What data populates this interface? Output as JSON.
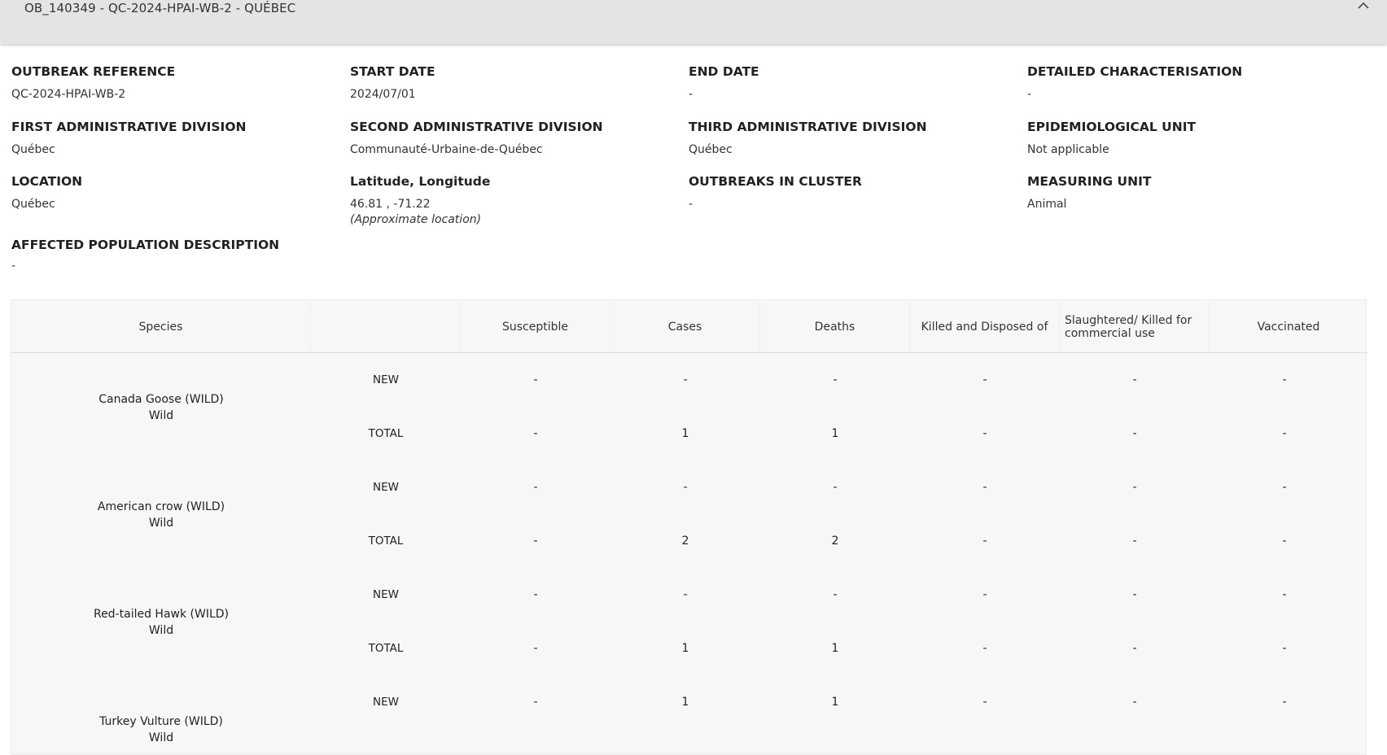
{
  "header": {
    "title": "OB_140349 - QC-2024-HPAI-WB-2 - QUÉBEC",
    "collapse_icon": "chevron-up-icon"
  },
  "details": {
    "outbreak_reference": {
      "label": "OUTBREAK REFERENCE",
      "value": "QC-2024-HPAI-WB-2"
    },
    "start_date": {
      "label": "START DATE",
      "value": "2024/07/01"
    },
    "end_date": {
      "label": "END DATE",
      "value": "-"
    },
    "detailed_characterisation": {
      "label": "DETAILED CHARACTERISATION",
      "value": "-"
    },
    "first_admin_division": {
      "label": "FIRST ADMINISTRATIVE DIVISION",
      "value": "Québec"
    },
    "second_admin_division": {
      "label": "SECOND ADMINISTRATIVE DIVISION",
      "value": "Communauté-Urbaine-de-Québec"
    },
    "third_admin_division": {
      "label": "THIRD ADMINISTRATIVE DIVISION",
      "value": "Québec"
    },
    "epidemiological_unit": {
      "label": "EPIDEMIOLOGICAL UNIT",
      "value": "Not applicable"
    },
    "location": {
      "label": "LOCATION",
      "value": "Québec"
    },
    "lat_long": {
      "label": "Latitude, Longitude",
      "value": "46.81 , -71.22",
      "note": "(Approximate location)"
    },
    "outbreaks_in_cluster": {
      "label": "OUTBREAKS IN CLUSTER",
      "value": "-"
    },
    "measuring_unit": {
      "label": "MEASURING UNIT",
      "value": "Animal"
    },
    "affected_population": {
      "label": "AFFECTED POPULATION DESCRIPTION",
      "value": "-"
    }
  },
  "table": {
    "columns": {
      "species": "Species",
      "type": "",
      "susceptible": "Susceptible",
      "cases": "Cases",
      "deaths": "Deaths",
      "killed": "Killed and Disposed of",
      "slaughtered": "Slaughtered/ Killed for commercial use",
      "vaccinated": "Vaccinated"
    },
    "rows": [
      {
        "species": "Canada Goose (WILD)",
        "category": "Wild",
        "new": {
          "label": "NEW",
          "susceptible": "-",
          "cases": "-",
          "deaths": "-",
          "killed": "-",
          "slaughtered": "-",
          "vaccinated": "-"
        },
        "total": {
          "label": "TOTAL",
          "susceptible": "-",
          "cases": "1",
          "deaths": "1",
          "killed": "-",
          "slaughtered": "-",
          "vaccinated": "-"
        }
      },
      {
        "species": "American crow (WILD)",
        "category": "Wild",
        "new": {
          "label": "NEW",
          "susceptible": "-",
          "cases": "-",
          "deaths": "-",
          "killed": "-",
          "slaughtered": "-",
          "vaccinated": "-"
        },
        "total": {
          "label": "TOTAL",
          "susceptible": "-",
          "cases": "2",
          "deaths": "2",
          "killed": "-",
          "slaughtered": "-",
          "vaccinated": "-"
        }
      },
      {
        "species": "Red-tailed Hawk (WILD)",
        "category": "Wild",
        "new": {
          "label": "NEW",
          "susceptible": "-",
          "cases": "-",
          "deaths": "-",
          "killed": "-",
          "slaughtered": "-",
          "vaccinated": "-"
        },
        "total": {
          "label": "TOTAL",
          "susceptible": "-",
          "cases": "1",
          "deaths": "1",
          "killed": "-",
          "slaughtered": "-",
          "vaccinated": "-"
        }
      },
      {
        "species": "Turkey Vulture (WILD)",
        "category": "Wild",
        "new": {
          "label": "NEW",
          "susceptible": "-",
          "cases": "1",
          "deaths": "1",
          "killed": "-",
          "slaughtered": "-",
          "vaccinated": "-"
        }
      }
    ]
  }
}
